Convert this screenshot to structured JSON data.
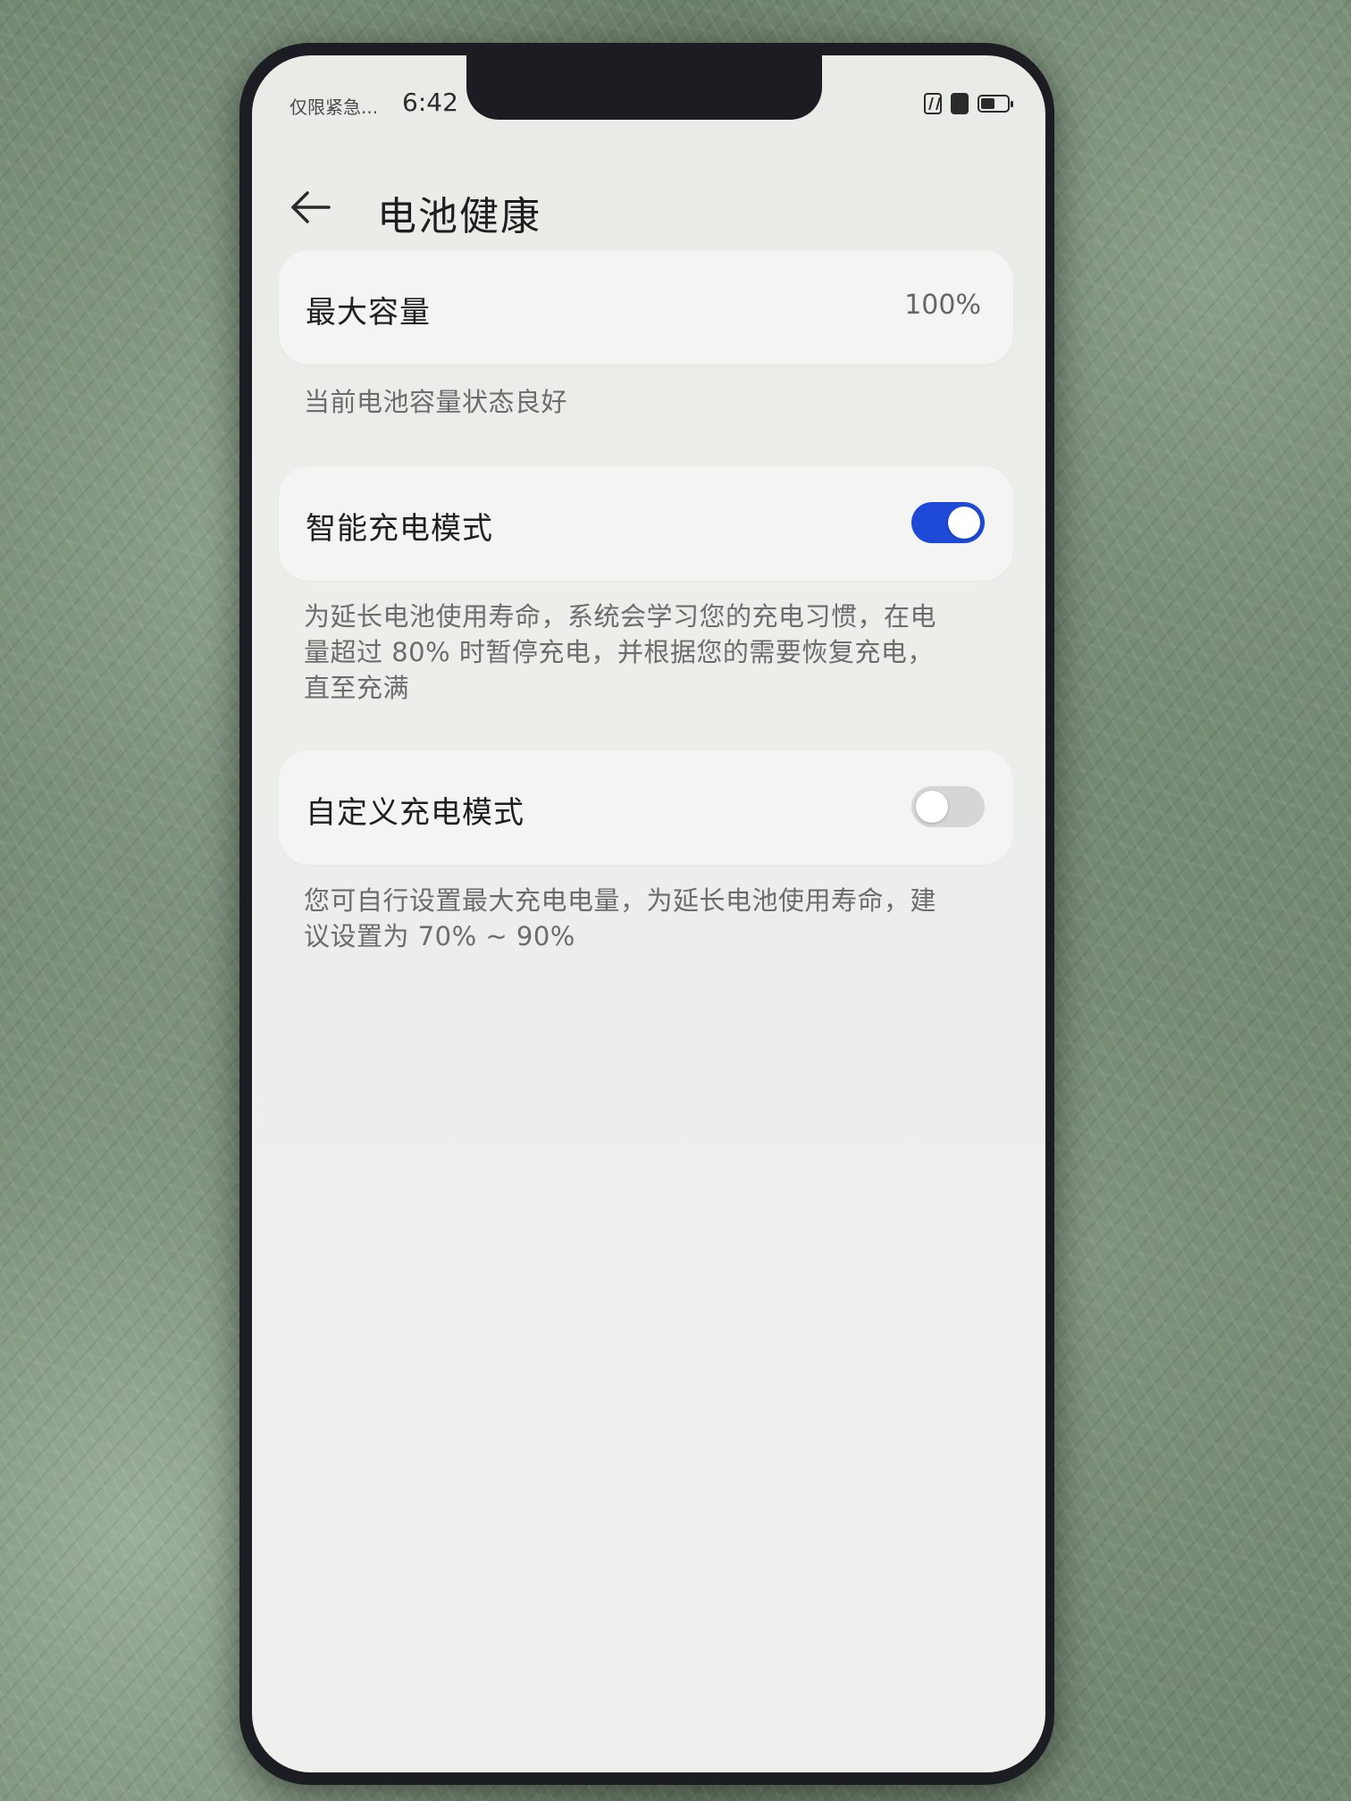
{
  "status_bar": {
    "carrier": "仅限紧急...",
    "time": "6:42"
  },
  "header": {
    "title": "电池健康"
  },
  "max_capacity": {
    "label": "最大容量",
    "value": "100%",
    "description": "当前电池容量状态良好"
  },
  "smart_charging": {
    "label": "智能充电模式",
    "enabled": true,
    "description_lines": [
      "为延长电池使用寿命，系统会学习您的充电习惯，在电",
      "量超过 80% 时暂停充电，并根据您的需要恢复充电，",
      "直至充满"
    ]
  },
  "custom_charging": {
    "label": "自定义充电模式",
    "enabled": false,
    "description_lines": [
      "您可自行设置最大充电电量，为延长电池使用寿命，建",
      "议设置为 70% ~ 90%"
    ]
  },
  "colors": {
    "toggle_on": "#1f4ad8",
    "toggle_off": "#d6d6d4"
  }
}
